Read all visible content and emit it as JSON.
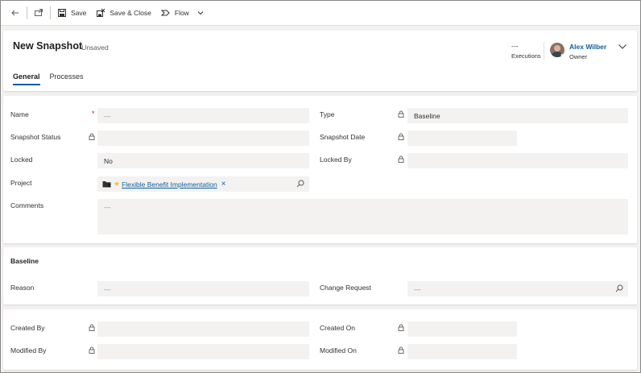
{
  "commands": {
    "save": "Save",
    "save_close": "Save & Close",
    "flow": "Flow"
  },
  "header": {
    "title": "New Snapshot",
    "status": "- Unsaved",
    "executions_value": "---",
    "executions_label": "Executions",
    "owner_name": "Alex Wilber",
    "owner_label": "Owner"
  },
  "tabs": [
    "General",
    "Processes"
  ],
  "general": {
    "name_label": "Name",
    "name_value": "---",
    "type_label": "Type",
    "type_value": "Baseline",
    "snapshot_status_label": "Snapshot Status",
    "snapshot_date_label": "Snapshot Date",
    "locked_label": "Locked",
    "locked_value": "No",
    "locked_by_label": "Locked By",
    "project_label": "Project",
    "project_value": "Flexible Benefit Implementation",
    "comments_label": "Comments",
    "comments_value": "---"
  },
  "baseline": {
    "section_title": "Baseline",
    "reason_label": "Reason",
    "reason_value": "---",
    "change_request_label": "Change Request",
    "change_request_value": "---"
  },
  "audit": {
    "created_by_label": "Created By",
    "created_on_label": "Created On",
    "modified_by_label": "Modified By",
    "modified_on_label": "Modified On"
  }
}
